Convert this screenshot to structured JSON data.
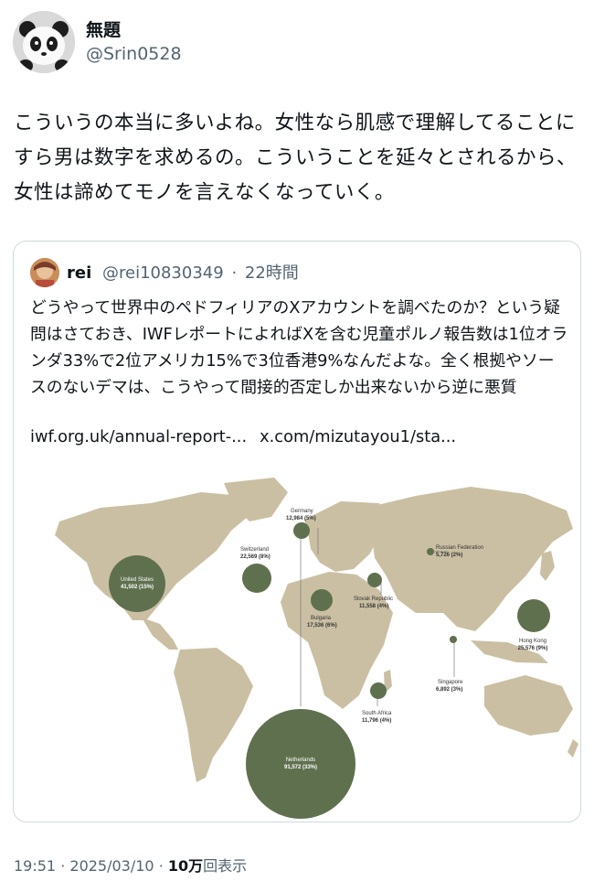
{
  "tweet": {
    "display_name": "無題",
    "handle": "@Srin0528",
    "text": "こういうの本当に多いよね。女性なら肌感で理解してることにすら男は数字を求めるの。こういうことを延々とされるから、女性は諦めてモノを言えなくなっていく。",
    "time": "19:51",
    "separator": "·",
    "date": "2025/03/10",
    "views_count": "10万",
    "views_label": "回表示"
  },
  "quote": {
    "display_name": "rei",
    "handle": "@rei10830349",
    "separator": "·",
    "time_ago": "22時間",
    "text": "どうやって世界中のペドフィリアのXアカウントを調べたのか？という疑問はさておき、IWFレポートによればXを含む児童ポルノ報告数は1位オランダ33%で2位アメリカ15%で3位香港9%なんだよな。全く根拠やソースのないデマは、こうやって間接的否定しか出来ないから逆に悪質",
    "link1": "iwf.org.uk/annual-report-...",
    "link2": "x.com/mizutayou1/sta..."
  },
  "map": {
    "land_color": "#cbbfa3",
    "bubble_color": "#5f704f",
    "countries": [
      {
        "name": "United States",
        "value": "41,502 (15%)"
      },
      {
        "name": "Netherlands",
        "value": "91,572 (33%)"
      },
      {
        "name": "Hong Kong",
        "value": "25,576 (9%)"
      },
      {
        "name": "Switzerland",
        "value": "22,569 (8%)"
      },
      {
        "name": "Bulgaria",
        "value": "17,536 (6%)"
      },
      {
        "name": "Germany",
        "value": "12,984 (5%)"
      },
      {
        "name": "Slovak Republic",
        "value": "11,558 (4%)"
      },
      {
        "name": "South Africa",
        "value": "11,796 (4%)"
      },
      {
        "name": "Singapore",
        "value": "6,892 (3%)"
      },
      {
        "name": "Russian Federation",
        "value": "5,726 (2%)"
      }
    ]
  }
}
